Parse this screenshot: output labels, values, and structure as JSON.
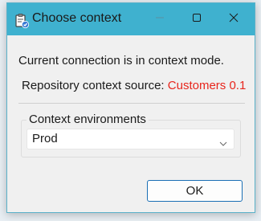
{
  "window": {
    "title": "Choose context",
    "icon": "clipboard-check-icon",
    "controls": {
      "minimize_icon": "minimize-icon",
      "maximize_icon": "maximize-icon",
      "close_icon": "close-icon"
    },
    "accent_color": "#3fb1cf"
  },
  "body": {
    "current_connection_text": "Current connection is in context mode.",
    "repository_label": "Repository context source:",
    "repository_value": "Customers 0.1",
    "repository_value_color": "#e8251c"
  },
  "context_group": {
    "label": "Context environments",
    "selected": "Prod"
  },
  "buttons": {
    "ok_label": "OK"
  }
}
